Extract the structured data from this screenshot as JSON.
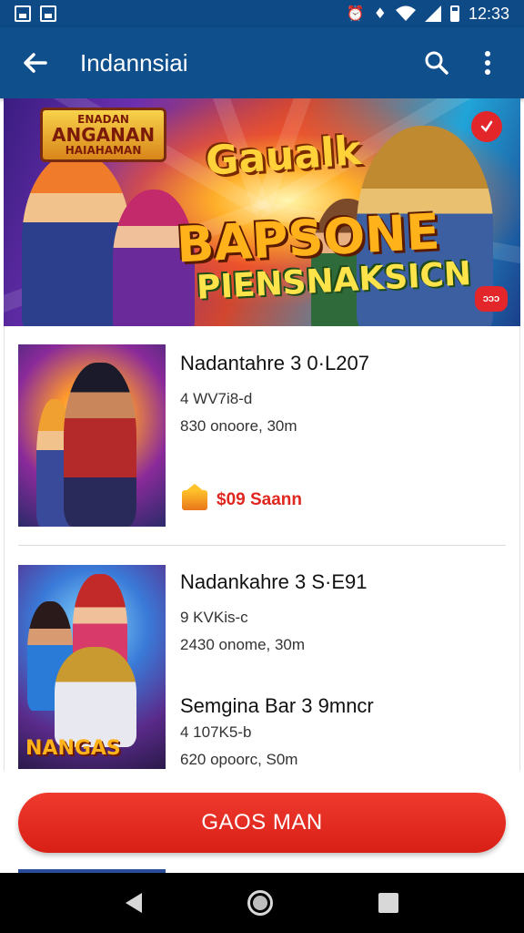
{
  "status_bar": {
    "time": "12:33",
    "icons": [
      "image-icon",
      "gallery-icon",
      "alarm-icon",
      "data-saver-icon",
      "wifi-icon",
      "signal-icon",
      "battery-icon"
    ]
  },
  "app_bar": {
    "title": "Indannsiai",
    "icons": [
      "back-arrow-icon",
      "search-icon",
      "more-vert-icon"
    ]
  },
  "banner": {
    "badge": [
      "ENADAN",
      "ANGANAN",
      "HAIAHAMAN"
    ],
    "title_line1": "Gaualk",
    "title_line2": "BAPSONE",
    "title_line3": "PIENSNAKSICN",
    "tag": "ᴐᴐᴐ",
    "icons": [
      "close-icon"
    ]
  },
  "items": [
    {
      "title": "Nadantahre 3 0·L207",
      "line1": "4 WV7i8-d",
      "line2": "830 onoore, 30m",
      "price": "$09 Saann"
    },
    {
      "title": "Nadankahre 3 S·E91",
      "line1": "9 KVKis-c",
      "line2": "2430 onome, 30m",
      "thumb_label": "NANGAS"
    },
    {
      "title": "Semgina Bar 3 9mncr",
      "line1": "4 107K5-b",
      "line2": "620 opoorc, S0m"
    }
  ],
  "cta": {
    "label": "GAOS MAN"
  },
  "colors": {
    "primary": "#0f4f8c",
    "status_bar": "#0d4a86",
    "accent_red": "#e3262a",
    "price_red": "#e0261e"
  }
}
